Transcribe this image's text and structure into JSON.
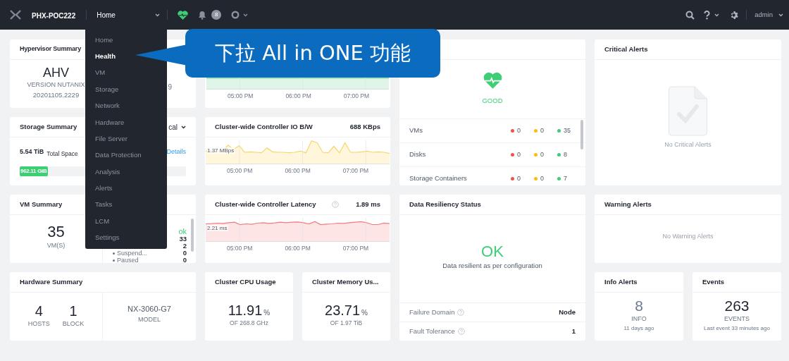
{
  "top_bar": {
    "cluster_name": "PHX-POC222",
    "nav_menu": "Home",
    "alert_count": "8",
    "user": "admin"
  },
  "nav_dropdown": {
    "items": [
      {
        "label": "Home",
        "selected": false
      },
      {
        "label": "Health",
        "selected": true
      },
      {
        "label": "VM",
        "selected": false
      },
      {
        "label": "Storage",
        "selected": false
      },
      {
        "label": "Network",
        "selected": false
      },
      {
        "label": "Hardware",
        "selected": false
      },
      {
        "label": "File Server",
        "selected": false
      },
      {
        "label": "Data Protection",
        "selected": false
      },
      {
        "label": "Analysis",
        "selected": false
      },
      {
        "label": "Alerts",
        "selected": false
      },
      {
        "label": "Tasks",
        "selected": false
      },
      {
        "label": "LCM",
        "selected": false
      },
      {
        "label": "Settings",
        "selected": false
      }
    ]
  },
  "callout": {
    "text": "下拉 All in ONE 功能"
  },
  "hypervisor_summary": {
    "title": "Hypervisor Summary",
    "hypervisor": "AHV",
    "version_label": "VERSION NUTANIX",
    "version": "20201105.2229",
    "column_2_value": "9"
  },
  "chart_panel": {
    "x_labels": [
      "05:00 PM",
      "06:00 PM",
      "07:00 PM"
    ]
  },
  "cluster_health": {
    "status": "GOOD",
    "rows": [
      {
        "label": "VMs",
        "critical": "0",
        "warning": "0",
        "good": "35"
      },
      {
        "label": "Disks",
        "critical": "0",
        "warning": "0",
        "good": "8"
      },
      {
        "label": "Storage Containers",
        "critical": "0",
        "warning": "0",
        "good": "7"
      }
    ]
  },
  "critical_alerts": {
    "title": "Critical Alerts",
    "message": "No Critical Alerts"
  },
  "storage_summary": {
    "title": "Storage Summary",
    "view_menu": "cal",
    "total": "5.54 TiB",
    "total_label": "Total Space",
    "details_link": "Details",
    "used": "962.11 GiB",
    "level": 0.17
  },
  "io_bandwidth": {
    "title": "Cluster-wide Controller IO B/W",
    "value": "688 KBps",
    "max_label": "1.37 MBps",
    "x_labels": [
      "05:00 PM",
      "06:00 PM",
      "07:00 PM"
    ]
  },
  "vm_summary": {
    "title": "VM Summary",
    "count": "35",
    "count_label": "VM(S)",
    "status": "ok",
    "states": [
      {
        "value": "33"
      },
      {
        "value": "2"
      },
      {
        "label": "Suspend...",
        "value": "0"
      },
      {
        "label": "Paused",
        "value": "0"
      }
    ]
  },
  "latency": {
    "title": "Cluster-wide Controller Latency",
    "value": "1.89 ms",
    "max_label": "2.21 ms",
    "x_labels": [
      "05:00 PM",
      "06:00 PM",
      "07:00 PM"
    ]
  },
  "data_resiliency": {
    "title": "Data Resiliency Status",
    "status": "OK",
    "message": "Data resilient as per configuration",
    "rows": [
      {
        "label": "Failure Domain",
        "value": "Node"
      },
      {
        "label": "Fault Tolerance",
        "value": "1"
      }
    ]
  },
  "warning_alerts": {
    "title": "Warning Alerts",
    "message": "No Warning Alerts"
  },
  "hardware_summary": {
    "title": "Hardware Summary",
    "stats": [
      {
        "value": "4",
        "label": "HOSTS"
      },
      {
        "value": "1",
        "label": "BLOCK"
      }
    ],
    "model": "NX-3060-G7",
    "model_label": "MODEL"
  },
  "cpu_usage": {
    "title": "Cluster CPU Usage",
    "value": "11.91",
    "unit": "%",
    "capacity": "OF 268.8 GHz"
  },
  "memory_usage": {
    "title": "Cluster Memory Us...",
    "value": "23.71",
    "unit": "%",
    "capacity": "OF 1.97 TiB"
  },
  "info_alerts": {
    "title": "Info Alerts",
    "count": "8",
    "label": "INFO",
    "time": "11 days ago"
  },
  "events": {
    "title": "Events",
    "count": "263",
    "label": "EVENTS",
    "time": "Last event 33 minutes ago"
  }
}
